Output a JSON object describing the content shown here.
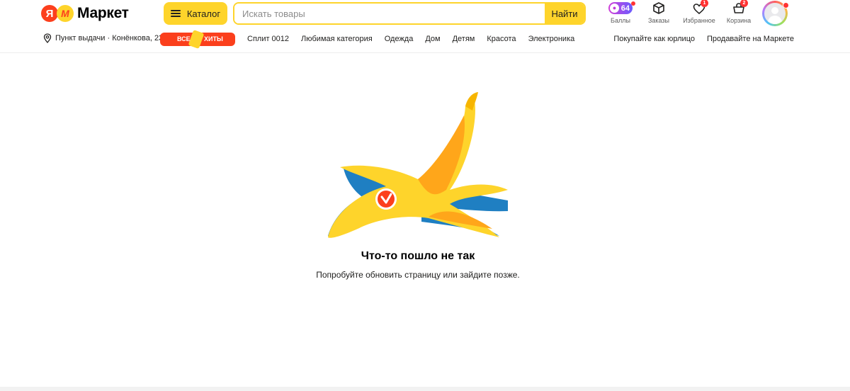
{
  "header": {
    "logo_letter": "Я",
    "logo_text": "Маркет",
    "catalog_label": "Каталог",
    "search_placeholder": "Искать товары",
    "search_button": "Найти",
    "icons": [
      {
        "label": "Баллы",
        "value": "64",
        "icon": "points-icon"
      },
      {
        "label": "Заказы",
        "icon": "box-icon"
      },
      {
        "label": "Избранное",
        "badge": "1",
        "icon": "heart-icon"
      },
      {
        "label": "Корзина",
        "badge": "2",
        "icon": "cart-icon"
      }
    ]
  },
  "subnav": {
    "pickup": "Пункт выдачи · Конёнкова, 23",
    "hits_left": "ВСЕ",
    "hits_right": "ХИТЫ",
    "links": [
      "Сплит 0012",
      "Любимая категория",
      "Одежда",
      "Дом",
      "Детям",
      "Красота",
      "Электроника"
    ],
    "right_links": [
      "Покупайте как юрлицо",
      "Продавайте на Маркете"
    ]
  },
  "error": {
    "title": "Что-то пошло не так",
    "text": "Попробуйте обновить страницу или зайдите позже."
  },
  "colors": {
    "accent_yellow": "#fed42b",
    "brand_red": "#fc3f1d",
    "banana_blue": "#1f7fc2"
  }
}
